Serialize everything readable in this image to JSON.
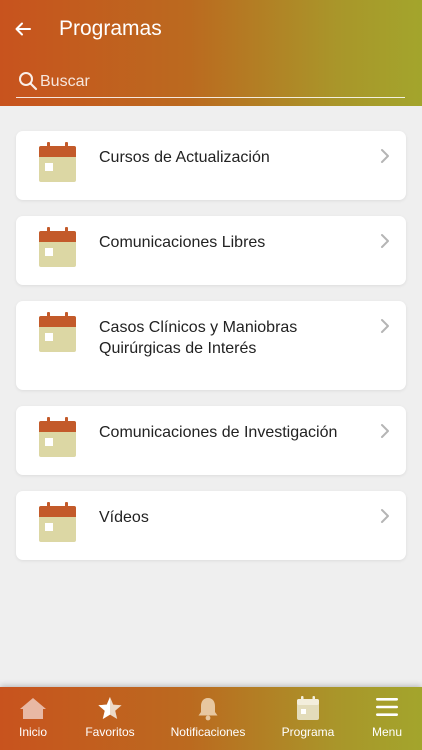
{
  "header": {
    "title": "Programas",
    "back_icon": "arrow-left-icon",
    "gradient_start": "#c8531e",
    "gradient_end": "#a3a52c"
  },
  "search": {
    "placeholder": "Buscar",
    "value": "",
    "icon": "search-icon"
  },
  "programs": [
    {
      "label": "Cursos de Actualización",
      "icon": "calendar-icon"
    },
    {
      "label": "Comunicaciones Libres",
      "icon": "calendar-icon"
    },
    {
      "label": "Casos Clínicos y Maniobras Quirúrgicas de Interés",
      "icon": "calendar-icon"
    },
    {
      "label": "Comunicaciones de Investigación",
      "icon": "calendar-icon"
    },
    {
      "label": "Vídeos",
      "icon": "calendar-icon"
    }
  ],
  "tabbar": {
    "items": [
      {
        "label": "Inicio",
        "icon": "home-icon"
      },
      {
        "label": "Favoritos",
        "icon": "star-icon"
      },
      {
        "label": "Notificaciones",
        "icon": "bell-icon"
      },
      {
        "label": "Programa",
        "icon": "calendar-icon"
      },
      {
        "label": "Menu",
        "icon": "menu-icon"
      }
    ]
  },
  "colors": {
    "calendar_top": "#c35a2a",
    "calendar_body": "#dcd7a4",
    "background": "#efefef"
  }
}
